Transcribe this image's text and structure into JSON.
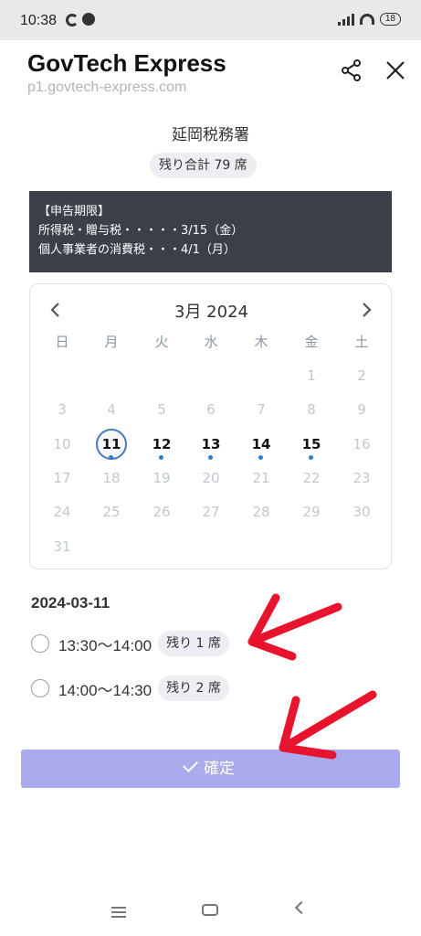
{
  "status_bar": {
    "time": "10:38",
    "battery": "18"
  },
  "header": {
    "title": "GovTech Express",
    "url": "p1.govtech-express.com"
  },
  "office": {
    "name": "延岡税務署",
    "remaining_total": "残り合計 79 席"
  },
  "deadline": {
    "heading": "【申告期限】",
    "lines": [
      "所得税・贈与税・・・・・3/15（金）",
      "個人事業者の消費税・・・4/1（月）"
    ]
  },
  "calendar": {
    "title": "3月 2024",
    "weekdays": [
      "日",
      "月",
      "火",
      "水",
      "木",
      "金",
      "土"
    ],
    "days": [
      {
        "d": "1",
        "s": "disabled"
      },
      {
        "d": "2",
        "s": "disabled"
      },
      {
        "d": "3",
        "s": "disabled"
      },
      {
        "d": "4",
        "s": "disabled"
      },
      {
        "d": "5",
        "s": "disabled"
      },
      {
        "d": "6",
        "s": "disabled"
      },
      {
        "d": "7",
        "s": "disabled"
      },
      {
        "d": "8",
        "s": "disabled"
      },
      {
        "d": "9",
        "s": "disabled"
      },
      {
        "d": "10",
        "s": "disabled"
      },
      {
        "d": "11",
        "s": "selected"
      },
      {
        "d": "12",
        "s": "available"
      },
      {
        "d": "13",
        "s": "available"
      },
      {
        "d": "14",
        "s": "available"
      },
      {
        "d": "15",
        "s": "available"
      },
      {
        "d": "16",
        "s": "disabled"
      },
      {
        "d": "17",
        "s": "disabled"
      },
      {
        "d": "18",
        "s": "disabled"
      },
      {
        "d": "19",
        "s": "disabled"
      },
      {
        "d": "20",
        "s": "disabled"
      },
      {
        "d": "21",
        "s": "disabled"
      },
      {
        "d": "22",
        "s": "disabled"
      },
      {
        "d": "23",
        "s": "disabled"
      },
      {
        "d": "24",
        "s": "disabled"
      },
      {
        "d": "25",
        "s": "disabled"
      },
      {
        "d": "26",
        "s": "disabled"
      },
      {
        "d": "27",
        "s": "disabled"
      },
      {
        "d": "28",
        "s": "disabled"
      },
      {
        "d": "29",
        "s": "disabled"
      },
      {
        "d": "30",
        "s": "disabled"
      },
      {
        "d": "31",
        "s": "disabled"
      }
    ],
    "first_weekday_index": 5
  },
  "selected_date": "2024-03-11",
  "slots": [
    {
      "time": "13:30〜14:00",
      "remaining": "残り 1 席"
    },
    {
      "time": "14:00〜14:30",
      "remaining": "残り 2 席"
    }
  ],
  "confirm_label": "確定",
  "colors": {
    "accent": "#aaabec",
    "dot": "#2d7ecb",
    "deadline_bg": "#3b3f49",
    "arrow": "#e8142e"
  }
}
